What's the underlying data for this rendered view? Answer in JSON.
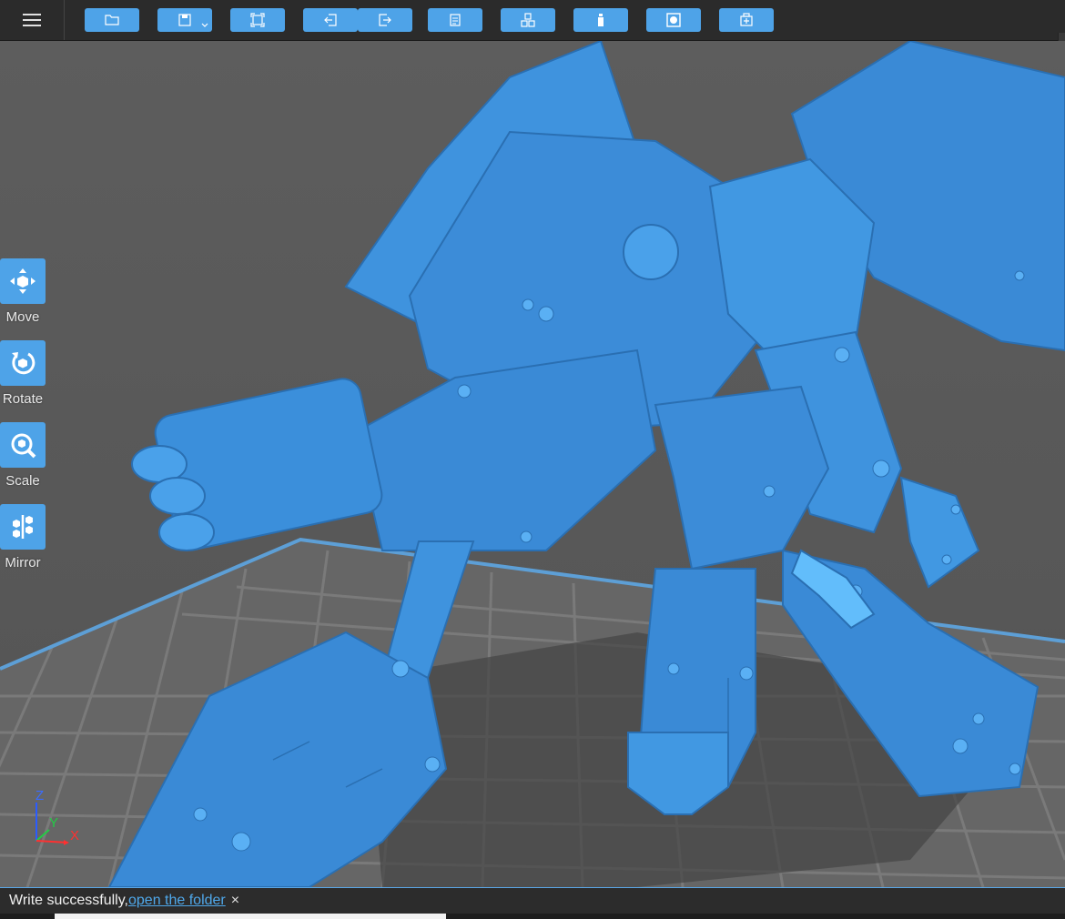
{
  "toolbar": {
    "buttons": [
      {
        "name": "open-file-button",
        "icon": "folder-icon"
      },
      {
        "name": "save-button",
        "icon": "save-icon"
      },
      {
        "name": "fit-view-button",
        "icon": "frame-icon"
      },
      {
        "name": "import-button",
        "icon": "import-icon"
      },
      {
        "name": "export-button",
        "icon": "export-icon"
      },
      {
        "name": "notes-button",
        "icon": "document-icon"
      },
      {
        "name": "arrange-button",
        "icon": "cubes-icon"
      },
      {
        "name": "support-button",
        "icon": "bottle-icon"
      },
      {
        "name": "hollow-button",
        "icon": "hollow-icon"
      },
      {
        "name": "add-model-button",
        "icon": "add-box-icon"
      }
    ],
    "accent": "#4ea3e8"
  },
  "side_tools": [
    {
      "id": "move",
      "label": "Move",
      "icon": "move-icon"
    },
    {
      "id": "rotate",
      "label": "Rotate",
      "icon": "rotate-icon"
    },
    {
      "id": "scale",
      "label": "Scale",
      "icon": "scale-icon"
    },
    {
      "id": "mirror",
      "label": "Mirror",
      "icon": "mirror-icon"
    }
  ],
  "axes": {
    "z": "Z",
    "y": "Y",
    "x": "X",
    "colors": {
      "z": "#2a5cff",
      "y": "#22cc44",
      "x": "#ff3030"
    }
  },
  "status": {
    "message": "Write successfully,",
    "link": "open the folder",
    "close": "×"
  },
  "model": {
    "color": "#3b8fdb"
  }
}
